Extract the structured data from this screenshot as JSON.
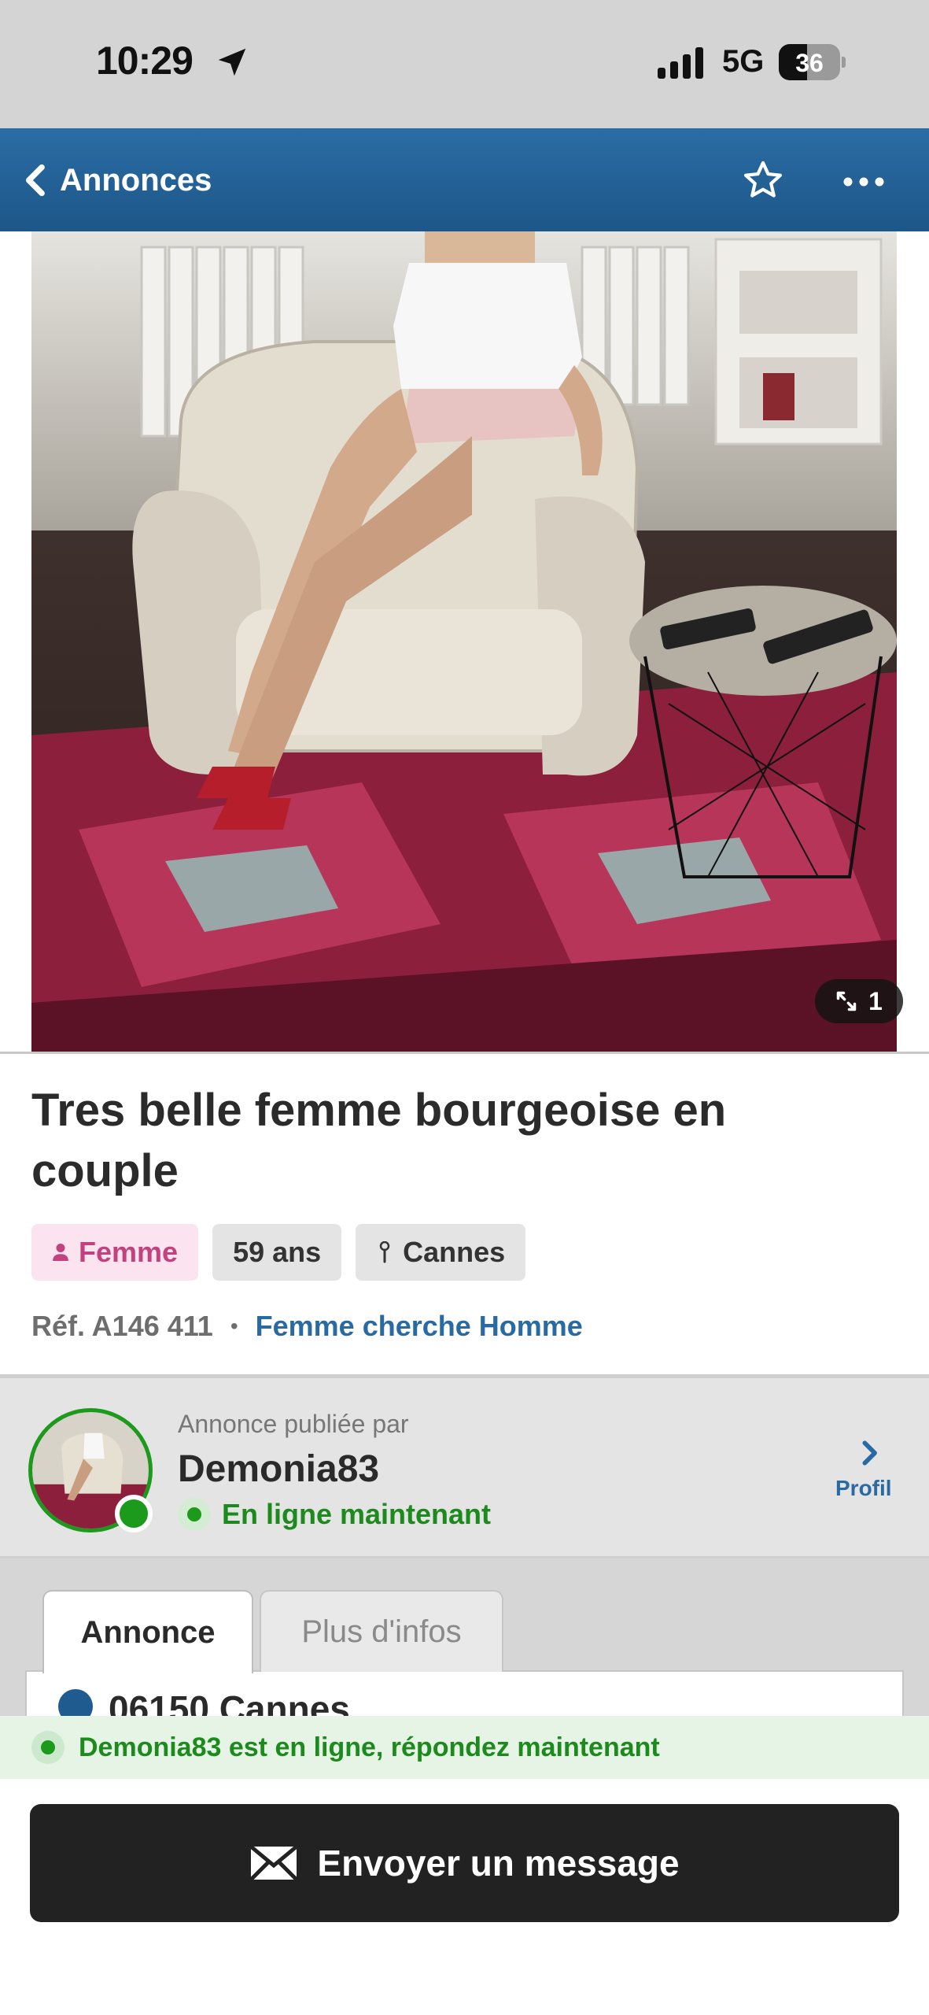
{
  "status_bar": {
    "time": "10:29",
    "network": "5G",
    "battery": "36"
  },
  "nav": {
    "back_label": "Annonces",
    "icons": [
      "chevron-left-icon",
      "star-icon",
      "more-icon"
    ]
  },
  "photo": {
    "count": "1"
  },
  "listing": {
    "title": "Tres belle femme bourgeoise en couple",
    "chips": {
      "gender": "Femme",
      "age": "59 ans",
      "city": "Cannes"
    },
    "ref": "Réf. A146 411",
    "separator": "•",
    "seeking": "Femme cherche Homme"
  },
  "publisher": {
    "label": "Annonce publiée par",
    "name": "Demonia83",
    "status": "En ligne maintenant",
    "profile_label": "Profil"
  },
  "tabs": {
    "active": "Annonce",
    "inactive": "Plus d'infos"
  },
  "content_preview": {
    "location": "06150 Cannes"
  },
  "banner": {
    "text": "Demonia83 est en ligne, répondez maintenant"
  },
  "actions": {
    "send_label": "Envoyer un message"
  },
  "colors": {
    "nav_blue": "#1d5688",
    "link_blue": "#2a6aa3",
    "online_green": "#1c9a1c",
    "pink_chip": "#c2417f",
    "button_dark": "#222222"
  }
}
